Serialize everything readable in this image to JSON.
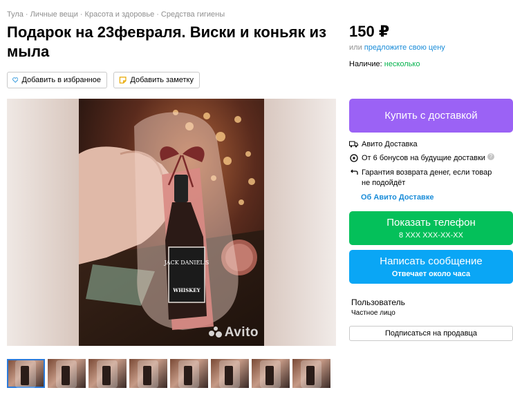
{
  "breadcrumbs": [
    "Тула",
    "Личные вещи",
    "Красота и здоровье",
    "Средства гигиены"
  ],
  "breadcrumb_separator": "·",
  "title": "Подарок на 23февраля. Виски и коньяк из мыла",
  "actions": {
    "favorite_label": "Добавить в избранное",
    "note_label": "Добавить заметку"
  },
  "price": {
    "value": "150 ₽",
    "or_text": "или",
    "offer_link": "предложите свою цену"
  },
  "availability": {
    "label": "Наличие:",
    "value": "несколько"
  },
  "buy_button": "Купить с доставкой",
  "delivery": {
    "service": "Авито Доставка",
    "bonus": "От 6 бонусов на будущие доставки",
    "help_icon": "?",
    "guarantee": "Гарантия возврата денег, если товар не подойдёт",
    "about_link": "Об Авито Доставке"
  },
  "phone_button": {
    "label": "Показать телефон",
    "number": "8 XXX XXX-XX-XX"
  },
  "message_button": {
    "label": "Написать сообщение",
    "sub": "Отвечает около часа"
  },
  "seller": {
    "name": "Пользователь",
    "type": "Частное лицо",
    "subscribe_label": "Подписаться на продавца"
  },
  "gallery": {
    "watermark": "Avito",
    "label_brand": "JACK DANIEL'S",
    "label_product": "WHISKEY",
    "thumbnail_count": 8
  },
  "colors": {
    "buy": "#9b62f5",
    "phone": "#04c05a",
    "message": "#0aa6f5",
    "link": "#1a8cd8",
    "available": "#04b34d"
  },
  "icons": [
    "heart-icon",
    "note-icon",
    "truck-icon",
    "bonus-icon",
    "return-icon",
    "avito-logo-icon"
  ]
}
